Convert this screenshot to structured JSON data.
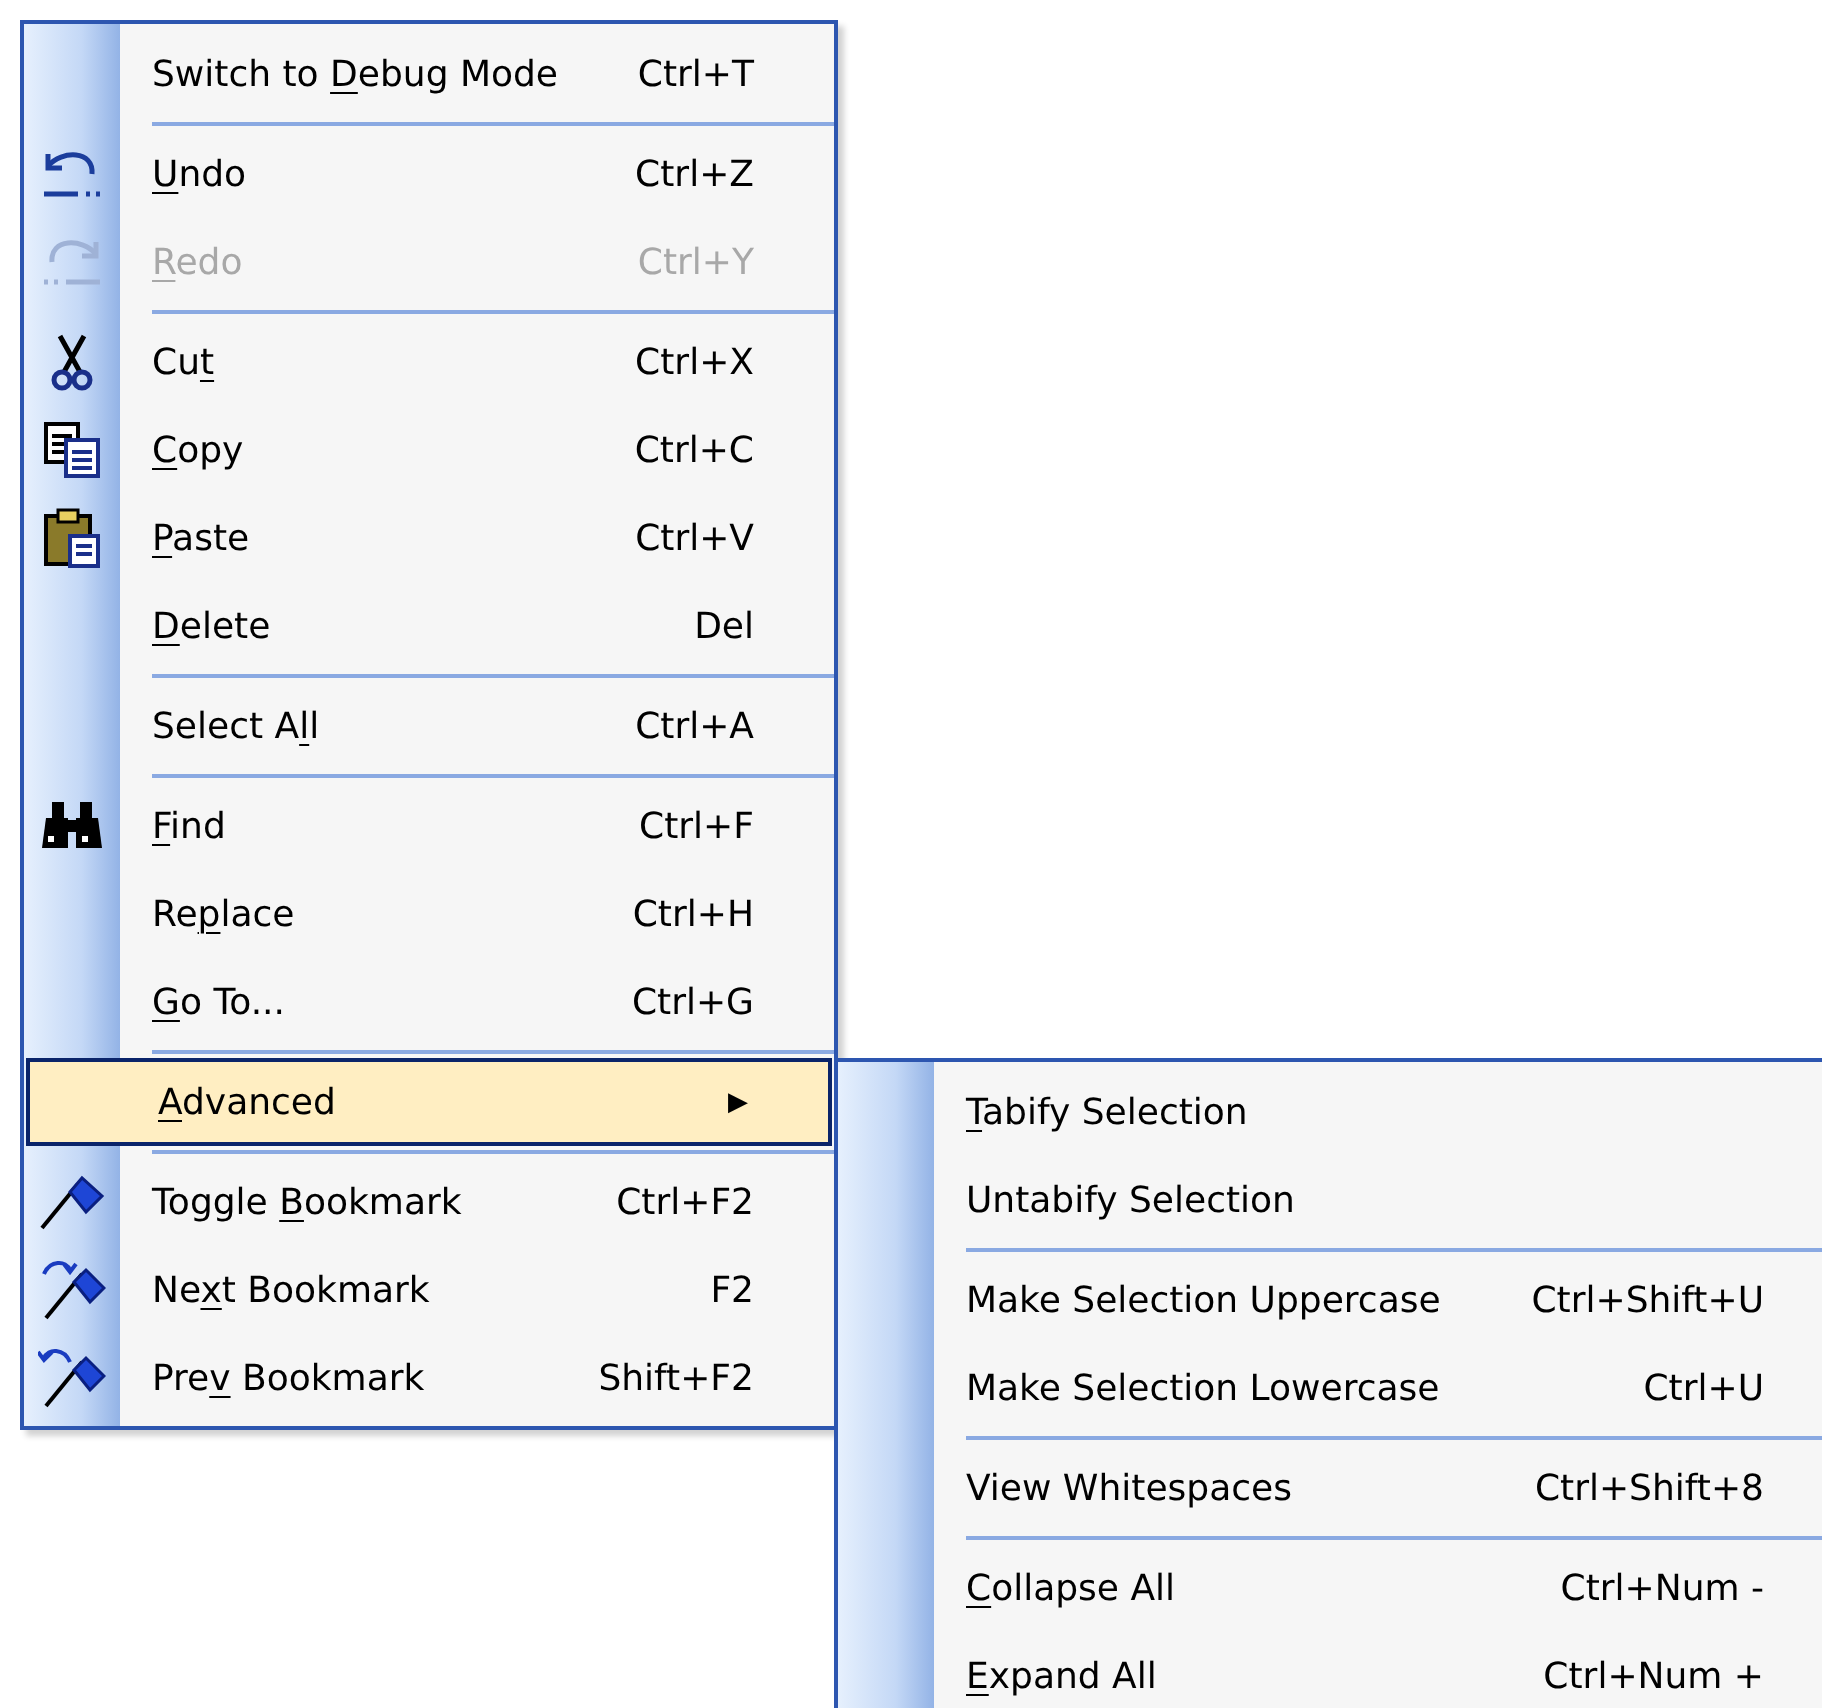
{
  "menu": {
    "items": [
      {
        "kind": "item",
        "label": {
          "before": "Switch to ",
          "key": "D",
          "after": "ebug Mode"
        },
        "shortcut": "Ctrl+T",
        "disabled": false,
        "selected": false
      },
      {
        "kind": "separator"
      },
      {
        "kind": "item",
        "label": {
          "key": "U",
          "after": "ndo"
        },
        "shortcut": "Ctrl+Z",
        "disabled": false,
        "selected": false
      },
      {
        "kind": "item",
        "label": {
          "key": "R",
          "after": "edo"
        },
        "shortcut": "Ctrl+Y",
        "disabled": true,
        "selected": false
      },
      {
        "kind": "separator"
      },
      {
        "kind": "item",
        "label": {
          "before": "Cu",
          "key": "t"
        },
        "shortcut": "Ctrl+X",
        "disabled": false,
        "selected": false
      },
      {
        "kind": "item",
        "label": {
          "key": "C",
          "after": "opy"
        },
        "shortcut": "Ctrl+C",
        "disabled": false,
        "selected": false
      },
      {
        "kind": "item",
        "label": {
          "key": "P",
          "after": "aste"
        },
        "shortcut": "Ctrl+V",
        "disabled": false,
        "selected": false
      },
      {
        "kind": "item",
        "label": {
          "key": "D",
          "after": "elete"
        },
        "shortcut": "Del",
        "disabled": false,
        "selected": false
      },
      {
        "kind": "separator"
      },
      {
        "kind": "item",
        "label": {
          "before": "Select A",
          "key": "l",
          "after": "l"
        },
        "shortcut": "Ctrl+A",
        "disabled": false,
        "selected": false
      },
      {
        "kind": "separator"
      },
      {
        "kind": "item",
        "label": {
          "key": "F",
          "after": "ind"
        },
        "shortcut": "Ctrl+F",
        "disabled": false,
        "selected": false
      },
      {
        "kind": "item",
        "label": {
          "before": "Re",
          "key": "p",
          "after": "lace"
        },
        "shortcut": "Ctrl+H",
        "disabled": false,
        "selected": false
      },
      {
        "kind": "item",
        "label": {
          "key": "G",
          "after": "o To..."
        },
        "shortcut": "Ctrl+G",
        "disabled": false,
        "selected": false
      },
      {
        "kind": "separator"
      },
      {
        "kind": "item",
        "label": {
          "key": "A",
          "after": "dvanced"
        },
        "submenu_arrow": "▶",
        "disabled": false,
        "selected": true
      },
      {
        "kind": "separator"
      },
      {
        "kind": "item",
        "label": {
          "before": "Toggle ",
          "key": "B",
          "after": "ookmark"
        },
        "shortcut": "Ctrl+F2",
        "disabled": false,
        "selected": false
      },
      {
        "kind": "item",
        "label": {
          "before": "Ne",
          "key": "x",
          "after": "t Bookmark"
        },
        "shortcut": "F2",
        "disabled": false,
        "selected": false
      },
      {
        "kind": "item",
        "label": {
          "before": "Pre",
          "key": "v",
          "after": " Bookmark"
        },
        "shortcut": "Shift+F2",
        "disabled": false,
        "selected": false
      }
    ]
  },
  "submenu": {
    "items": [
      {
        "kind": "item",
        "label": {
          "key": "T",
          "after": "abify Selection"
        },
        "disabled": false,
        "selected": false
      },
      {
        "kind": "item",
        "label": {
          "before": "Untabify Selection"
        },
        "disabled": false,
        "selected": false
      },
      {
        "kind": "separator"
      },
      {
        "kind": "item",
        "label": {
          "before": "Make Selection Uppercase"
        },
        "shortcut": "Ctrl+Shift+U",
        "disabled": false,
        "selected": false
      },
      {
        "kind": "item",
        "label": {
          "before": "Make Selection Lowercase"
        },
        "shortcut": "Ctrl+U",
        "disabled": false,
        "selected": false
      },
      {
        "kind": "separator"
      },
      {
        "kind": "item",
        "label": {
          "before": "View Whitespaces"
        },
        "shortcut": "Ctrl+Shift+8",
        "disabled": false,
        "selected": false
      },
      {
        "kind": "separator"
      },
      {
        "kind": "item",
        "label": {
          "key": "C",
          "after": "ollapse All"
        },
        "shortcut": "Ctrl+Num -",
        "disabled": false,
        "selected": false
      },
      {
        "kind": "item",
        "label": {
          "key": "E",
          "after": "xpand All"
        },
        "shortcut": "Ctrl+Num +",
        "disabled": false,
        "selected": false
      }
    ]
  }
}
